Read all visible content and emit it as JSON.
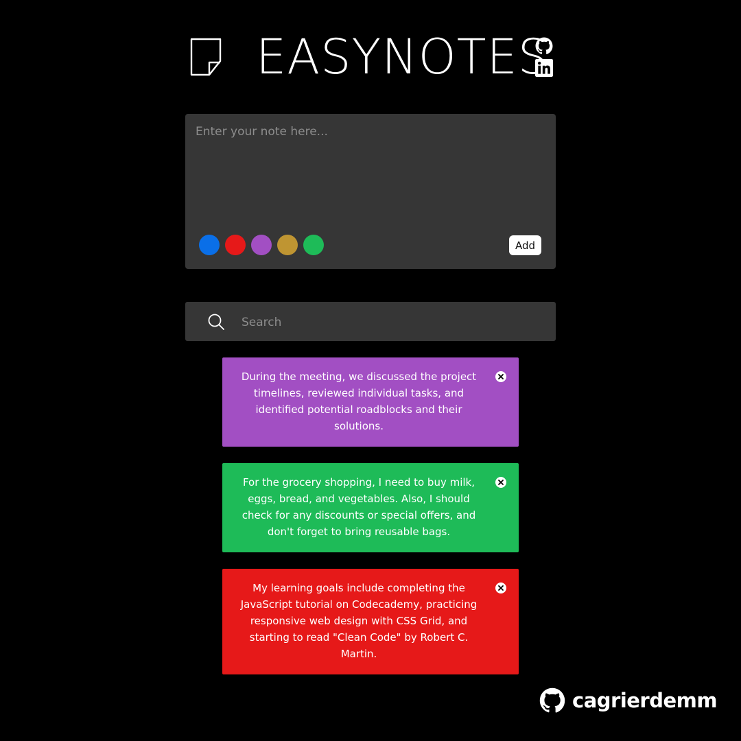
{
  "header": {
    "title": "EASYNOTES",
    "logo_icon": "sticky-note-icon",
    "social": [
      {
        "name": "github-icon"
      },
      {
        "name": "linkedin-icon"
      }
    ]
  },
  "editor": {
    "placeholder": "Enter your note here...",
    "value": "",
    "colors": [
      "#0a6fe8",
      "#e61919",
      "#a24fc3",
      "#bf9532",
      "#1ebb58"
    ],
    "add_label": "Add"
  },
  "search": {
    "placeholder": "Search",
    "value": "",
    "icon": "search-icon"
  },
  "notes": [
    {
      "text": "During the meeting, we discussed the project timelines, reviewed individual tasks, and identified potential roadblocks and their solutions.",
      "color": "#a24fc3"
    },
    {
      "text": "For the grocery shopping, I need to buy milk, eggs, bread, and vegetables. Also, I should check for any discounts or special offers, and don't forget to bring reusable bags.",
      "color": "#1ebb58"
    },
    {
      "text": "My learning goals include completing the JavaScript tutorial on Codecademy, practicing responsive web design with CSS Grid, and starting to read \"Clean Code\" by Robert C. Martin.",
      "color": "#e61919"
    }
  ],
  "footer": {
    "username": "cagrierdemm",
    "icon": "github-icon"
  }
}
